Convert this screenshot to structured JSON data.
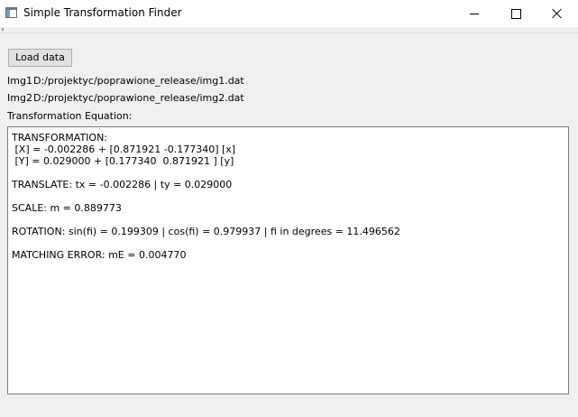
{
  "window": {
    "title": "Simple Transformation Finder",
    "controls": [
      "minimize",
      "maximize",
      "close"
    ]
  },
  "toolbar": {
    "load_label": "Load data"
  },
  "files": {
    "img1_label": "Img1",
    "img1_path": "D:/projektyc/poprawione_release/img1.dat",
    "img2_label": "Img2",
    "img2_path": "D:/projektyc/poprawione_release/img2.dat"
  },
  "equation": {
    "label": "Transformation Equation:"
  },
  "output": {
    "lines": [
      "TRANSFORMATION:",
      " [X] = -0.002286 + [0.871921 -0.177340] [x]",
      " [Y] = 0.029000 + [0.177340  0.871921 ] [y]",
      "",
      "TRANSLATE: tx = -0.002286 | ty = 0.029000",
      "",
      "SCALE: m = 0.889773",
      "",
      "ROTATION: sin(fi) = 0.199309 | cos(fi) = 0.979937 | fi in degrees = 11.496562",
      "",
      "MATCHING ERROR: mE = 0.004770"
    ]
  }
}
